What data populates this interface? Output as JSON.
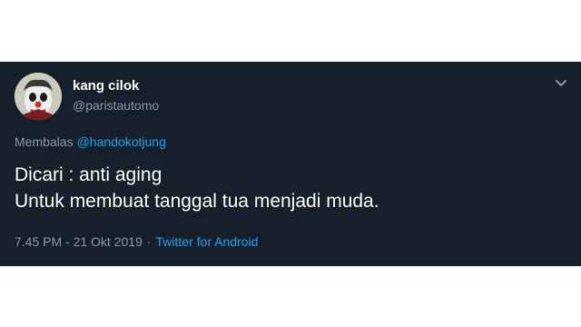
{
  "tweet": {
    "display_name": "kang cilok",
    "handle": "@paristautomo",
    "reply_prefix": "Membalas",
    "reply_to": "@handokotjung",
    "text_line_1": "Dicari : anti aging",
    "text_line_2": "Untuk membuat tanggal tua menjadi muda.",
    "timestamp": "7.45 PM - 21 Okt 2019",
    "separator": "·",
    "source": "Twitter for Android"
  },
  "icons": {
    "avatar": "clown-avatar",
    "more": "chevron-down-icon"
  },
  "colors": {
    "background": "#15202b",
    "text": "#ffffff",
    "secondary": "#8899a6",
    "link": "#1da1f2"
  }
}
